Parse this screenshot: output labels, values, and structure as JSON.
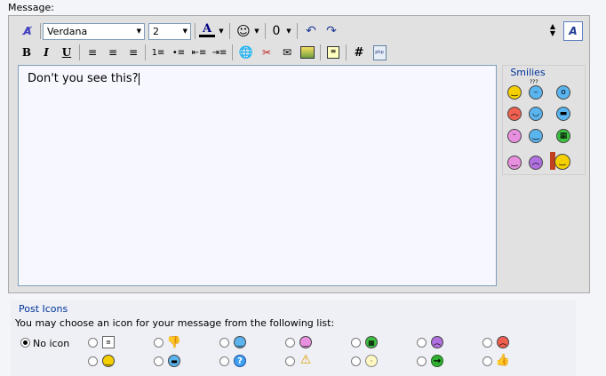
{
  "message_label": "Message:",
  "toolbar": {
    "font_value": "Verdana",
    "size_value": "2",
    "bold": "B",
    "italic": "I",
    "underline": "U",
    "font_color_letter": "A",
    "hash": "#",
    "php": "php",
    "mode_letter": "A"
  },
  "editor": {
    "text": "Don't you see this?"
  },
  "smilies": {
    "title": "Smilies",
    "confused_text": "???"
  },
  "post_icons": {
    "title": "Post Icons",
    "description": "You may choose an icon for your message from the following list:",
    "no_icon_label": "No icon"
  },
  "colors": {
    "smiley_yellow": "#f5d000",
    "smiley_blue": "#5ab4ee",
    "smiley_red": "#f06050",
    "smiley_green": "#3cc040",
    "smiley_purple": "#b070e0",
    "smiley_pink": "#e890e0",
    "link_blue": "#003399"
  }
}
